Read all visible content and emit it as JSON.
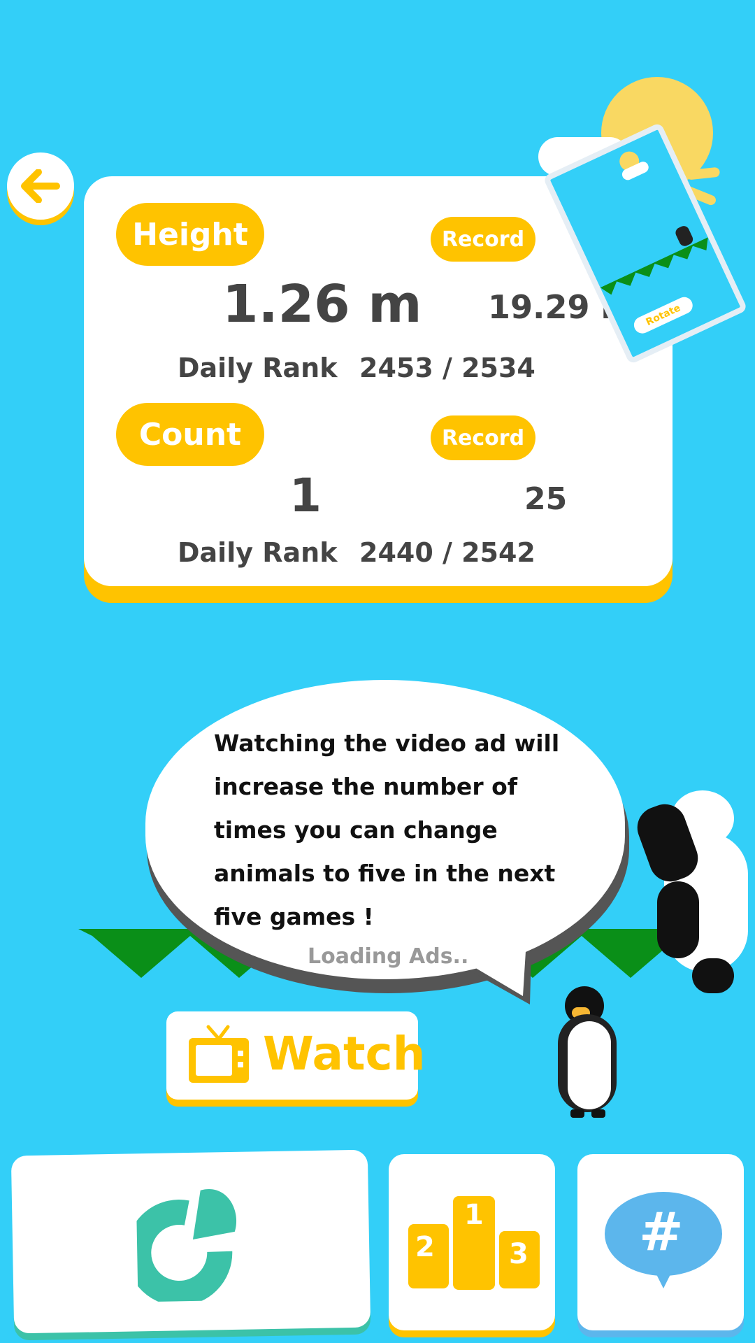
{
  "colors": {
    "background": "#33CFF8",
    "accent": "#FFC300",
    "grass": "#0A8F18",
    "restart": "#3CC2A8",
    "share": "#5CB6EC",
    "text_dark": "#444444"
  },
  "height": {
    "label": "Height",
    "value": "1.26 m",
    "record_label": "Record",
    "record_value": "19.29 m",
    "rank_label": "Daily Rank",
    "rank_value": "2453 / 2534"
  },
  "count": {
    "label": "Count",
    "value": "1",
    "record_label": "Record",
    "record_value": "25",
    "rank_label": "Daily Rank",
    "rank_value": "2440 / 2542"
  },
  "minimap": {
    "rotate_label": "Rotate"
  },
  "ad": {
    "message": "Watching the video ad will increase the number of times you can change animals to five in the next five games !",
    "loading": "Loading Ads..",
    "watch_label": "Watch"
  },
  "ranking": {
    "first": "1",
    "second": "2",
    "third": "3"
  },
  "share": {
    "icon_label": "#"
  },
  "icons": {
    "back": "arrow-left-icon",
    "tv": "tv-icon",
    "restart": "restart-icon",
    "ranking": "podium-icon",
    "share": "hashtag-icon"
  }
}
